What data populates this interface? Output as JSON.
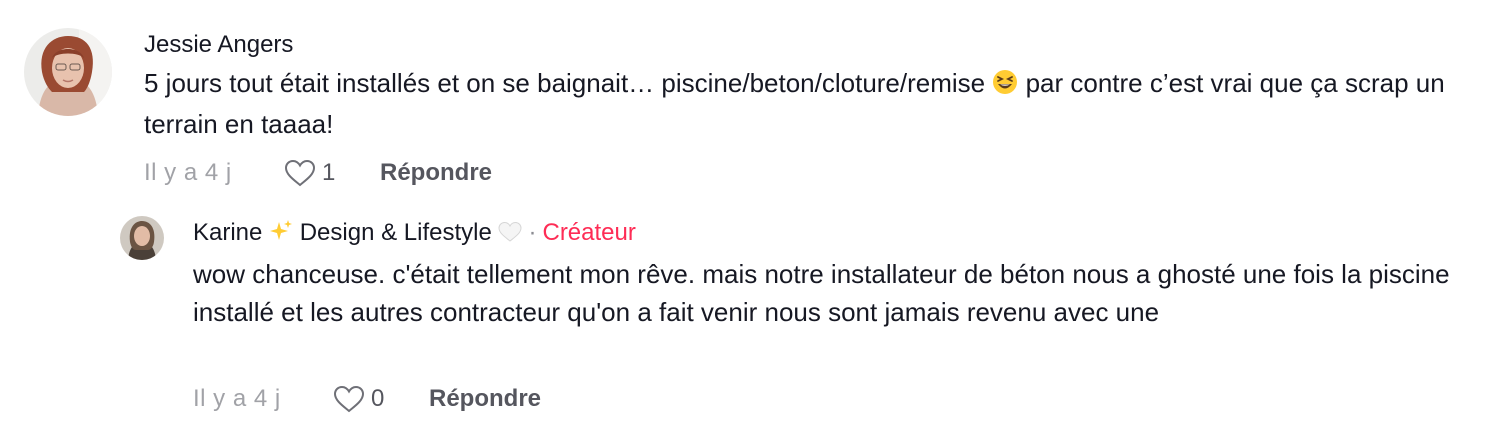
{
  "comments": [
    {
      "author": "Jessie Angers",
      "text_before_emoji": "5 jours tout était installés et on se baignait… piscine/beton/cloture/remise ",
      "emoji": "grinning-squinting-face",
      "text_after_emoji": " par contre c’est vrai que ça scrap un terrain en taaaa!",
      "time": "Il y a 4 j",
      "likes": "1",
      "reply_label": "Répondre"
    },
    {
      "author_prefix": "Karine ",
      "author_emoji_1": "sparkles",
      "author_middle": " Design & Lifestyle ",
      "author_emoji_2": "white-heart",
      "separator": "·",
      "creator_badge": "Créateur",
      "text": "wow chanceuse. c'était tellement mon rêve. mais notre installateur de béton nous a ghosté une fois la piscine installé et les autres contracteur qu'on a fait venir nous sont jamais revenu avec une",
      "time": "Il y a 4 j",
      "likes": "0",
      "reply_label": "Répondre"
    }
  ],
  "colors": {
    "creator": "#fe2c55",
    "meta": "#a1a2a7",
    "text": "#161823"
  }
}
